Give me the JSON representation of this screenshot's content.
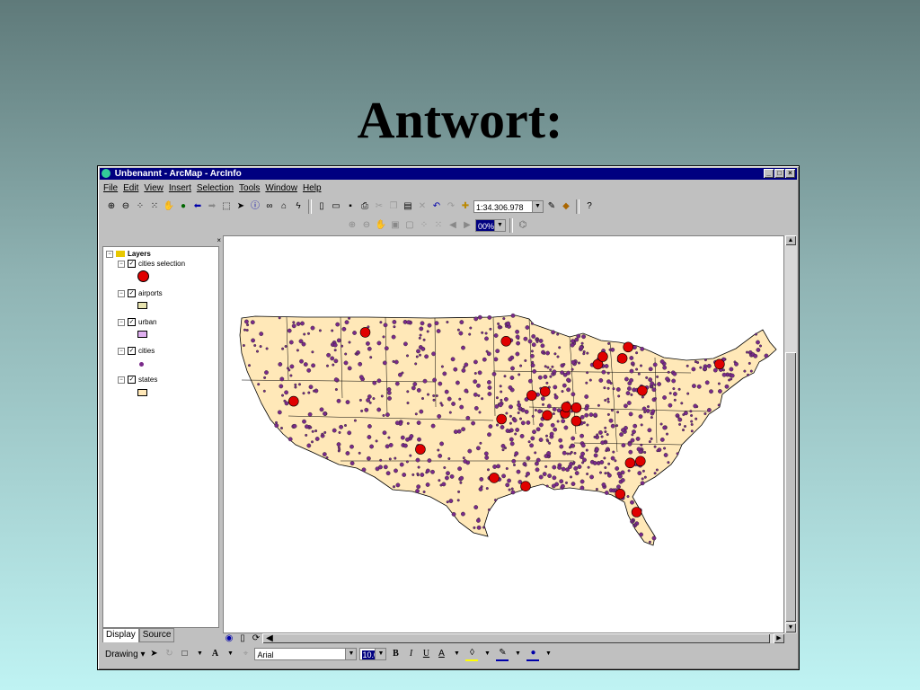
{
  "slide": {
    "title": "Antwort:"
  },
  "window": {
    "title": "Unbenannt - ArcMap - ArcInfo",
    "controls": [
      "_",
      "□",
      "×"
    ]
  },
  "menu": [
    "File",
    "Edit",
    "View",
    "Insert",
    "Selection",
    "Tools",
    "Window",
    "Help"
  ],
  "toolbar": {
    "scale": "1:34.306.978"
  },
  "layout_toolbar": {
    "zoom": "00%"
  },
  "toc": {
    "root": "Layers",
    "layers": [
      {
        "name": "cities selection",
        "symbol": "red-circle",
        "color": "#e00000"
      },
      {
        "name": "airports",
        "symbol": "rect",
        "color": "#e8e4b0"
      },
      {
        "name": "urban",
        "symbol": "rect",
        "color": "#e0b0f0"
      },
      {
        "name": "cities",
        "symbol": "dot",
        "color": "#7a2a8a"
      },
      {
        "name": "states",
        "symbol": "rect",
        "color": "#ffe8b8"
      }
    ],
    "close": "×"
  },
  "tabs": {
    "display": "Display",
    "source": "Source"
  },
  "drawing": {
    "drawing_label": "Drawing ▾",
    "font": "Arial",
    "size": "10.0",
    "bold": "B",
    "italic": "I",
    "underline": "U",
    "font_color": "A"
  },
  "colors": {
    "land": "#ffe8b8",
    "city": "#7a2a8a",
    "selected": "#e00000",
    "titlebar": "#000080"
  }
}
